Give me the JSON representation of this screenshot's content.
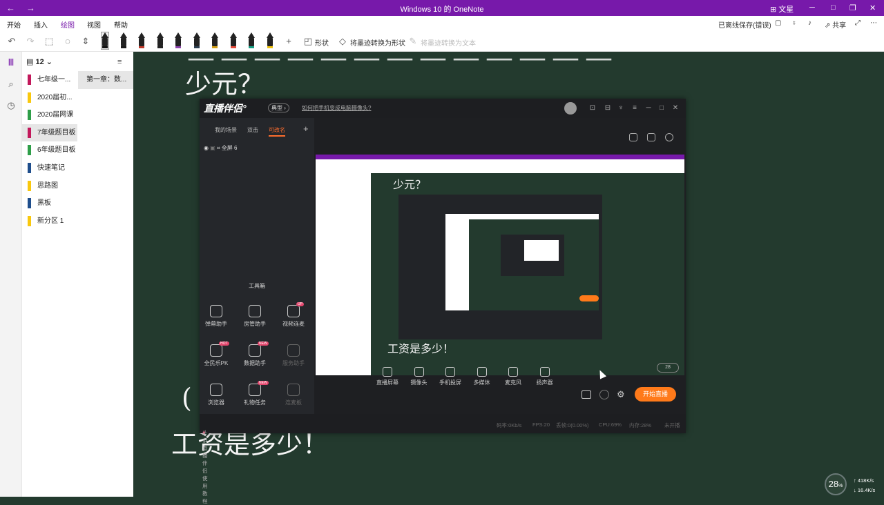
{
  "titlebar": {
    "title": "Windows 10 的 OneNote",
    "user": "文星",
    "back": "←",
    "forward": "→"
  },
  "menu": {
    "tabs": [
      "开始",
      "插入",
      "绘图",
      "视图",
      "帮助"
    ],
    "active_tab": "绘图",
    "status": "已离线保存(错误)",
    "share": "共享"
  },
  "ribbon": {
    "shapes_label": "形状",
    "ink_to_shape": "将墨迹转换为形状",
    "ink_to_text": "将墨迹转换为文本",
    "pen_colors": [
      "#111111",
      "#1a1a1a",
      "#c0392b",
      "#222222",
      "#8e44ad",
      "#2c3e50",
      "#d4a017",
      "#e74c3c",
      "#16a085",
      "#f1c40f"
    ]
  },
  "notebook": {
    "name": "12",
    "sections": [
      {
        "label": "七年级一...",
        "color": "#c2185b"
      },
      {
        "label": "2020届初...",
        "color": "#f9c80e"
      },
      {
        "label": "2020届网课",
        "color": "#2e9e48"
      },
      {
        "label": "7年级题目板",
        "color": "#c2185b"
      },
      {
        "label": "6年级题目板",
        "color": "#2e9e48"
      },
      {
        "label": "快速笔记",
        "color": "#1f4e8c"
      },
      {
        "label": "思路图",
        "color": "#f9c80e"
      },
      {
        "label": "黑板",
        "color": "#1f4e8c"
      },
      {
        "label": "新分区 1",
        "color": "#f9c80e"
      }
    ],
    "active_section": "7年级题目板",
    "pages": [
      "第一章：数..."
    ]
  },
  "canvas": {
    "handwriting_line1": "少元？",
    "handwriting_line2": "工资是多少！",
    "handwriting_paren": "("
  },
  "live_app": {
    "logo": "直播伴侣°",
    "badge": "典型 ›",
    "help_link": "如何把手机变成电脑摄像头?",
    "tabs": [
      "我的场景",
      "双击",
      "可改名"
    ],
    "active_tab": "可改名",
    "scene_item": "全屏 6",
    "toolbox_title": "工具箱",
    "tools": [
      {
        "label": "弹幕助手",
        "badge": "",
        "dim": false
      },
      {
        "label": "房管助手",
        "badge": "",
        "dim": false
      },
      {
        "label": "视频连麦",
        "badge": "UP",
        "dim": false
      },
      {
        "label": "全民乐PK",
        "badge": "HOT",
        "dim": false
      },
      {
        "label": "數据助手",
        "badge": "NEW",
        "dim": false
      },
      {
        "label": "服务助手",
        "badge": "",
        "dim": true
      },
      {
        "label": "浏览器",
        "badge": "",
        "dim": false
      },
      {
        "label": "礼物任务",
        "badge": "NEW",
        "dim": false
      },
      {
        "label": "连麦板",
        "badge": "",
        "dim": true
      }
    ],
    "bottom_tools": [
      "直播屏幕",
      "摄像头",
      "手机投屏",
      "多媒体",
      "麦克风",
      "扬声器"
    ],
    "start_button": "开始直播",
    "footer_link": "头条直播伴侣使用教程",
    "status": {
      "bitrate": "码率:0Kb/s",
      "fps": "FPS:20",
      "drop": "丢帧:0(0.00%)",
      "cpu": "CPU:69%",
      "mem": "内存:28%",
      "state": "未开播"
    }
  },
  "net_widget": {
    "percent": "28",
    "percent_unit": "%",
    "up": "↑ 418K/s",
    "down": "↓ 16.4K/s"
  }
}
